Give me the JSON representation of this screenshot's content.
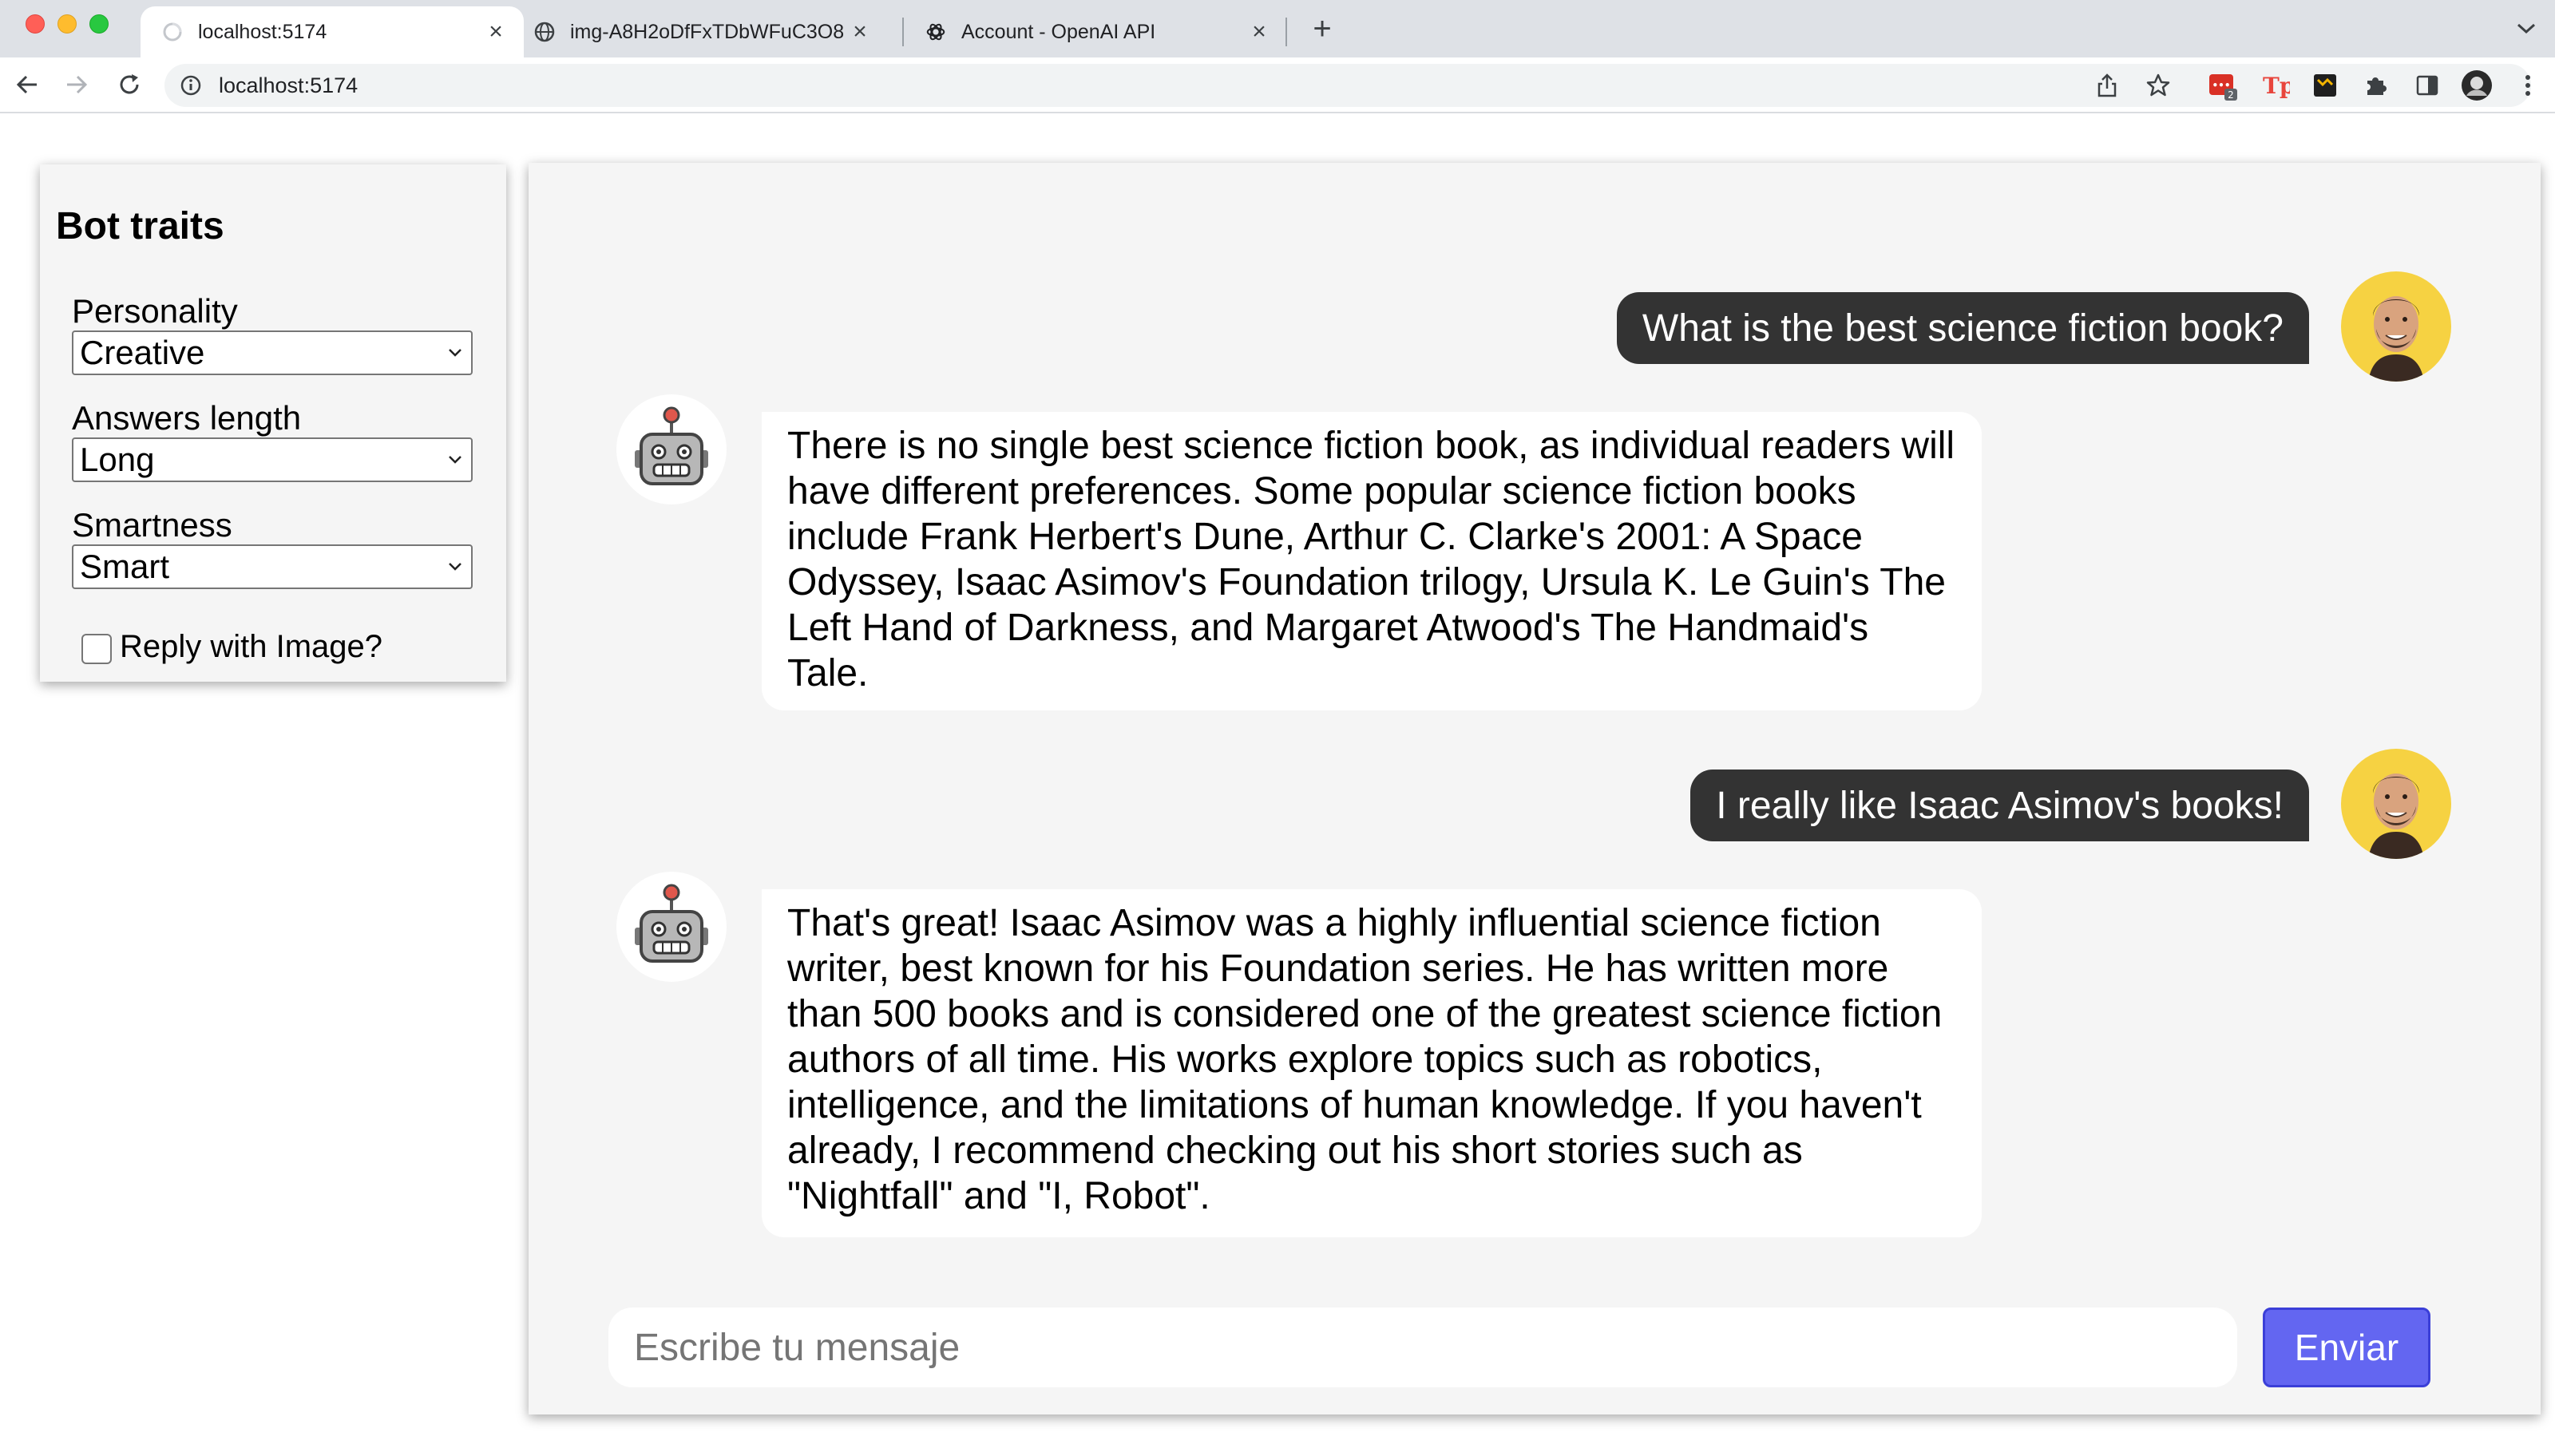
{
  "browser": {
    "tabs": [
      {
        "title": "localhost:5174",
        "active": true
      },
      {
        "title": "img-A8H2oDfFxTDbWFuC3O8",
        "active": false
      },
      {
        "title": "Account - OpenAI API",
        "active": false
      }
    ],
    "url": "localhost:5174",
    "extension_badge": "2"
  },
  "sidebar": {
    "title": "Bot traits",
    "personality": {
      "label": "Personality",
      "value": "Creative"
    },
    "answers_length": {
      "label": "Answers length",
      "value": "Long"
    },
    "smartness": {
      "label": "Smartness",
      "value": "Smart"
    },
    "reply_with_image": {
      "label": "Reply with Image?",
      "checked": false
    }
  },
  "chat": {
    "messages": [
      {
        "role": "user",
        "text": "What is the best science fiction book?"
      },
      {
        "role": "bot",
        "text": "There is no single best science fiction book, as individual readers will have different preferences. Some popular science fiction books include Frank Herbert's Dune, Arthur C. Clarke's 2001: A Space Odyssey, Isaac Asimov's Foundation trilogy, Ursula K. Le Guin's The Left Hand of Darkness, and Margaret Atwood's The Handmaid's Tale."
      },
      {
        "role": "user",
        "text": "I really like Isaac Asimov's books!"
      },
      {
        "role": "bot",
        "text": "That's great! Isaac Asimov was a highly influential science fiction writer, best known for his Foundation series. He has written more than 500 books and is considered one of the greatest science fiction authors of all time. His works explore topics such as robotics, intelligence, and the limitations of human knowledge. If you haven't already, I recommend checking out his short stories such as \"Nightfall\" and \"I, Robot\"."
      }
    ],
    "input": {
      "placeholder": "Escribe tu mensaje",
      "value": ""
    },
    "send_label": "Enviar"
  },
  "colors": {
    "user_bubble": "#333333",
    "bot_bubble": "#ffffff",
    "send_button": "#6366f1",
    "avatar_bg": "#f6d242"
  }
}
